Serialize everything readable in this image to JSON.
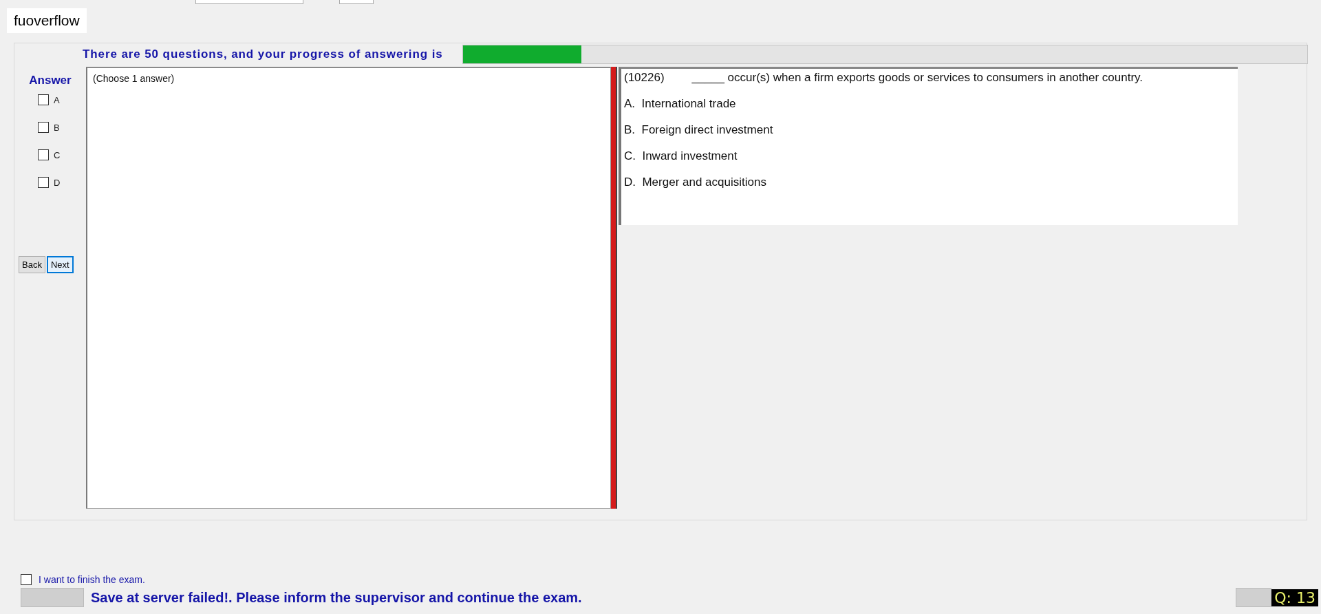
{
  "user_label": "fuoverflow",
  "progress": {
    "text": "There are 50 questions, and your progress of answering is",
    "level": 0.14
  },
  "answer_panel": {
    "title": "Answer",
    "options": [
      {
        "label": "A",
        "checked": false
      },
      {
        "label": "B",
        "checked": false
      },
      {
        "label": "C",
        "checked": false
      },
      {
        "label": "D",
        "checked": false
      }
    ],
    "buttons": [
      {
        "label": "Back",
        "selected": false
      },
      {
        "label": "Next",
        "selected": true
      }
    ]
  },
  "answer_box": {
    "hint": "(Choose 1 answer)"
  },
  "question": {
    "number": "(10226)",
    "text": "_____ occur(s) when a firm exports goods or services to consumers in another country.",
    "choices": [
      "A.  International trade",
      "B.  Foreign direct investment",
      "C.  Inward investment",
      "D.  Merger and acquisitions"
    ]
  },
  "finish": {
    "label": "I want to finish the exam.",
    "checked": false
  },
  "status_message": "Save at server failed!. Please inform the supervisor and continue the exam.",
  "question_counter": "Q: 13"
}
